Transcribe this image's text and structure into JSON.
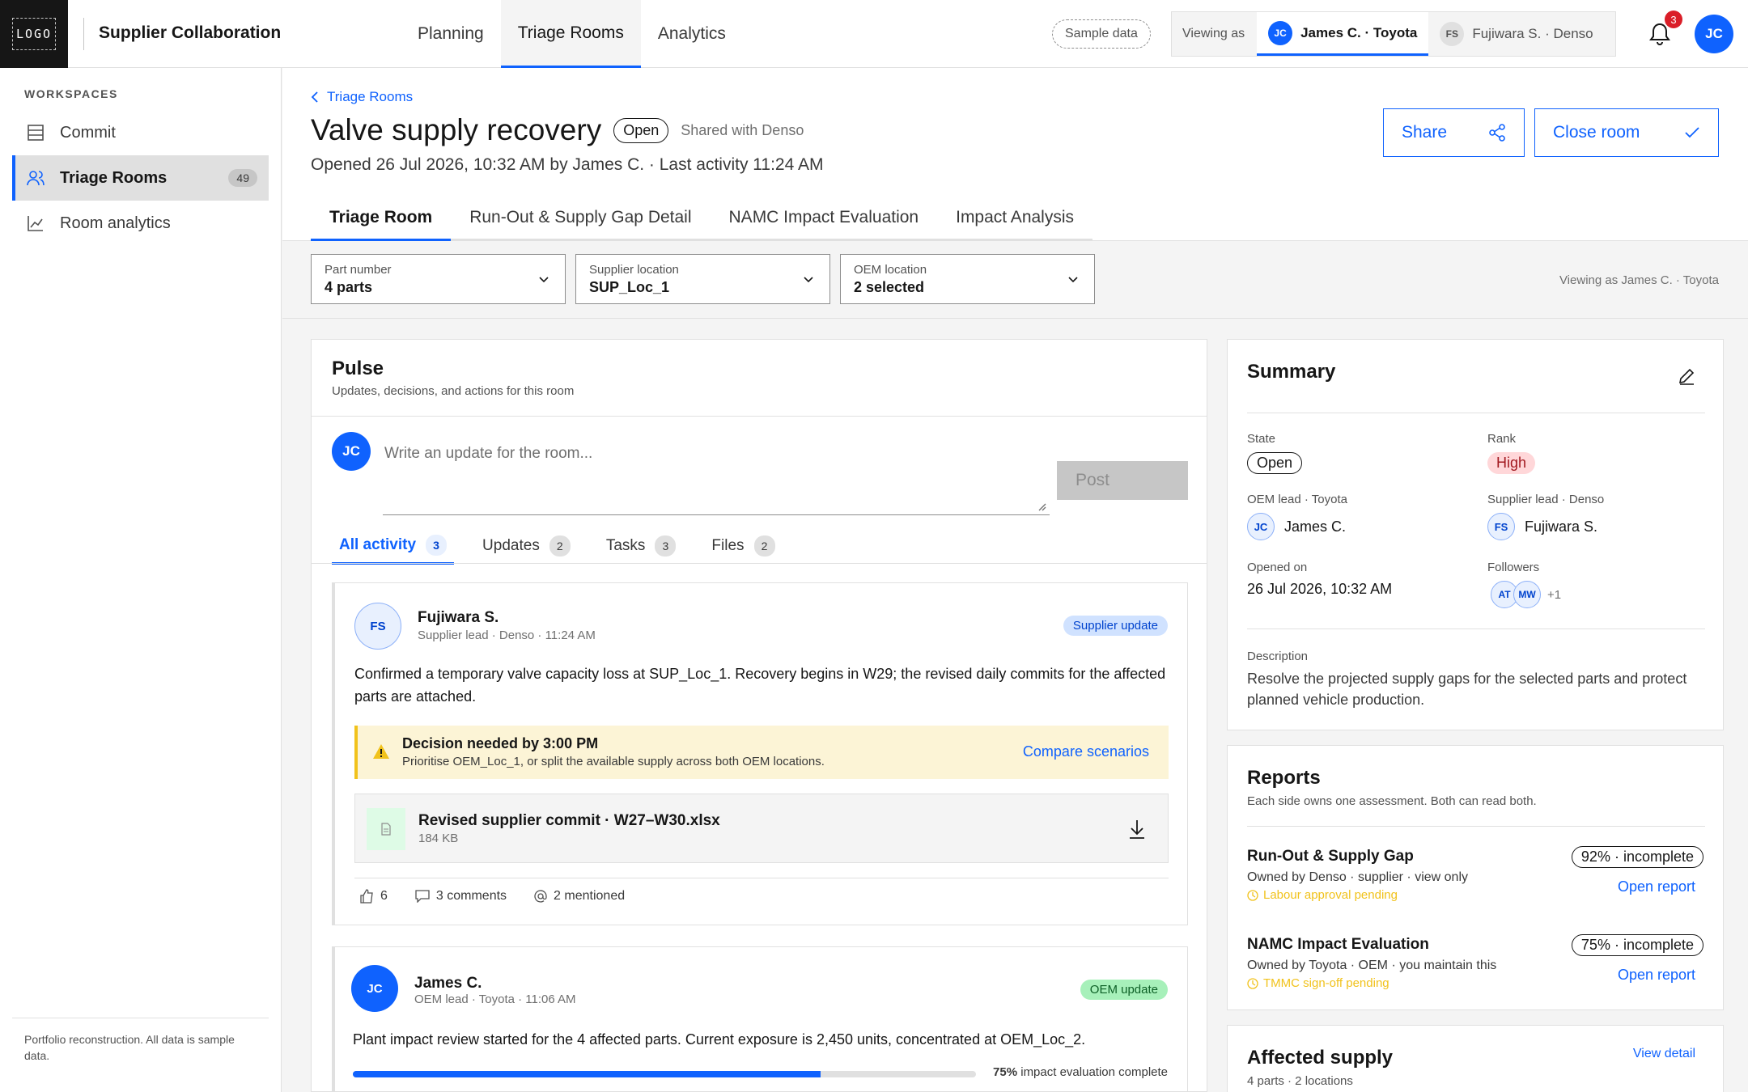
{
  "app": {
    "logo": "LOGO",
    "title": "Supplier Collaboration"
  },
  "topnav": [
    "Planning",
    "Triage Rooms",
    "Analytics"
  ],
  "sample_data": "Sample data",
  "viewing_as": {
    "label": "Viewing as",
    "options": [
      {
        "initials": "JC",
        "name": "James C. · Toyota"
      },
      {
        "initials": "FS",
        "name": "Fujiwara S. · Denso"
      }
    ]
  },
  "notifications": {
    "count": "3"
  },
  "user": {
    "initials": "JC"
  },
  "sidebar": {
    "heading": "WORKSPACES",
    "items": [
      {
        "label": "Commit",
        "icon": "list-icon"
      },
      {
        "label": "Triage Rooms",
        "icon": "users-icon",
        "count": "49"
      },
      {
        "label": "Room analytics",
        "icon": "chart-icon"
      }
    ],
    "footer": "Portfolio reconstruction. All data is sample data."
  },
  "room": {
    "breadcrumb": "Triage Rooms",
    "title": "Valve supply recovery",
    "status": "Open",
    "shared": "Shared with Denso",
    "subline": "Opened 26 Jul 2026, 10:32 AM by James C. · Last activity 11:24 AM",
    "share_label": "Share",
    "close_label": "Close room",
    "tabs": [
      "Triage Room",
      "Run-Out & Supply Gap Detail",
      "NAMC Impact Evaluation",
      "Impact Analysis"
    ]
  },
  "filters": [
    {
      "label": "Part number",
      "value": "4 parts"
    },
    {
      "label": "Supplier location",
      "value": "SUP_Loc_1"
    },
    {
      "label": "OEM location",
      "value": "2 selected"
    }
  ],
  "filters_note": "Viewing as James C. · Toyota",
  "pulse": {
    "title": "Pulse",
    "subtitle": "Updates, decisions, and actions for this room",
    "compose_placeholder": "Write an update for the room...",
    "compose_initials": "JC",
    "post_label": "Post",
    "tabs": [
      {
        "label": "All activity",
        "count": "3"
      },
      {
        "label": "Updates",
        "count": "2"
      },
      {
        "label": "Tasks",
        "count": "3"
      },
      {
        "label": "Files",
        "count": "2"
      }
    ],
    "posts": [
      {
        "initials": "FS",
        "name": "Fujiwara S.",
        "meta": "Supplier lead · Denso · 11:24 AM",
        "tag": "Supplier update",
        "body": "Confirmed a temporary valve capacity loss at SUP_Loc_1. Recovery begins in W29; the revised daily commits for the affected parts are attached.",
        "decision_title": "Decision needed by 3:00 PM",
        "decision_desc": "Prioritise OEM_Loc_1, or split the available supply across both OEM locations.",
        "decision_link": "Compare scenarios",
        "file_name": "Revised supplier commit · W27–W30.xlsx",
        "file_size": "184 KB",
        "likes": "6",
        "comments": "3 comments",
        "mentions": "2 mentioned"
      },
      {
        "initials": "JC",
        "name": "James C.",
        "meta": "OEM lead · Toyota · 11:06 AM",
        "tag": "OEM update",
        "body": "Plant impact review started for the 4 affected parts. Current exposure is 2,450 units, concentrated at OEM_Loc_2.",
        "progress_value": 0.75,
        "progress_pct": "75%",
        "progress_text": "impact evaluation complete"
      }
    ]
  },
  "summary": {
    "title": "Summary",
    "state_label": "State",
    "state": "Open",
    "rank_label": "Rank",
    "rank": "High",
    "oem_lead_label": "OEM lead · Toyota",
    "oem_lead": {
      "initials": "JC",
      "name": "James C."
    },
    "supplier_lead_label": "Supplier lead · Denso",
    "supplier_lead": {
      "initials": "FS",
      "name": "Fujiwara S."
    },
    "opened_label": "Opened on",
    "opened": "26 Jul 2026, 10:32 AM",
    "followers_label": "Followers",
    "followers": [
      "AT",
      "MW"
    ],
    "followers_more": "+1",
    "description_label": "Description",
    "description": "Resolve the projected supply gaps for the selected parts and protect planned vehicle production."
  },
  "reports": {
    "title": "Reports",
    "subtitle": "Each side owns one assessment. Both can read both.",
    "items": [
      {
        "name": "Run-Out & Supply Gap",
        "owner": "Owned by Denso · supplier · view only",
        "pending": "Labour approval pending",
        "pct": "92% · incomplete",
        "link": "Open report"
      },
      {
        "name": "NAMC Impact Evaluation",
        "owner": "Owned by Toyota · OEM · you maintain this",
        "pending": "TMMC sign-off pending",
        "pct": "75% · incomplete",
        "link": "Open report"
      }
    ]
  },
  "affected": {
    "title": "Affected supply",
    "subtitle": "4 parts · 2 locations",
    "link": "View detail"
  }
}
